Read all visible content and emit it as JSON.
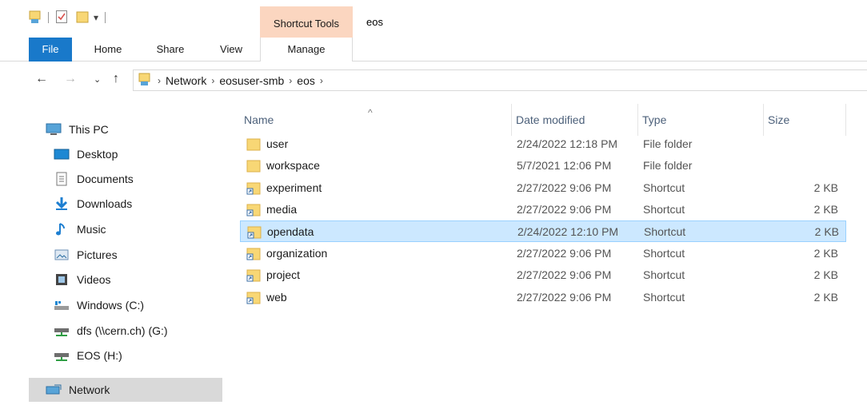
{
  "window": {
    "title": "eos",
    "context_tab": "Shortcut Tools"
  },
  "ribbon": {
    "tabs": [
      "File",
      "Home",
      "Share",
      "View",
      "Manage"
    ]
  },
  "address": {
    "crumbs": [
      "Network",
      "eosuser-smb",
      "eos"
    ]
  },
  "navpane": {
    "items": [
      {
        "label": "This PC",
        "icon": "computer-icon"
      },
      {
        "label": "Desktop",
        "icon": "desktop-icon"
      },
      {
        "label": "Documents",
        "icon": "documents-icon"
      },
      {
        "label": "Downloads",
        "icon": "downloads-icon"
      },
      {
        "label": "Music",
        "icon": "music-icon"
      },
      {
        "label": "Pictures",
        "icon": "pictures-icon"
      },
      {
        "label": "Videos",
        "icon": "videos-icon"
      },
      {
        "label": "Windows (C:)",
        "icon": "drive-icon"
      },
      {
        "label": "dfs (\\\\cern.ch) (G:)",
        "icon": "network-drive-icon"
      },
      {
        "label": "EOS (H:)",
        "icon": "network-drive-icon"
      },
      {
        "label": "Network",
        "icon": "network-icon"
      }
    ],
    "selected": "Network"
  },
  "columns": {
    "name": "Name",
    "date": "Date modified",
    "type": "Type",
    "size": "Size"
  },
  "files": [
    {
      "name": "user",
      "date": "2/24/2022 12:18 PM",
      "type": "File folder",
      "size": ""
    },
    {
      "name": "workspace",
      "date": "5/7/2021 12:06 PM",
      "type": "File folder",
      "size": ""
    },
    {
      "name": "experiment",
      "date": "2/27/2022 9:06 PM",
      "type": "Shortcut",
      "size": "2 KB"
    },
    {
      "name": "media",
      "date": "2/27/2022 9:06 PM",
      "type": "Shortcut",
      "size": "2 KB"
    },
    {
      "name": "opendata",
      "date": "2/24/2022 12:10 PM",
      "type": "Shortcut",
      "size": "2 KB"
    },
    {
      "name": "organization",
      "date": "2/27/2022 9:06 PM",
      "type": "Shortcut",
      "size": "2 KB"
    },
    {
      "name": "project",
      "date": "2/27/2022 9:06 PM",
      "type": "Shortcut",
      "size": "2 KB"
    },
    {
      "name": "web",
      "date": "2/27/2022 9:06 PM",
      "type": "Shortcut",
      "size": "2 KB"
    }
  ],
  "selected_file": "opendata",
  "colors": {
    "file_tab": "#1979ca",
    "context_tab": "#fbd6c0",
    "selection": "#cce8ff",
    "folder": "#f8d775"
  }
}
